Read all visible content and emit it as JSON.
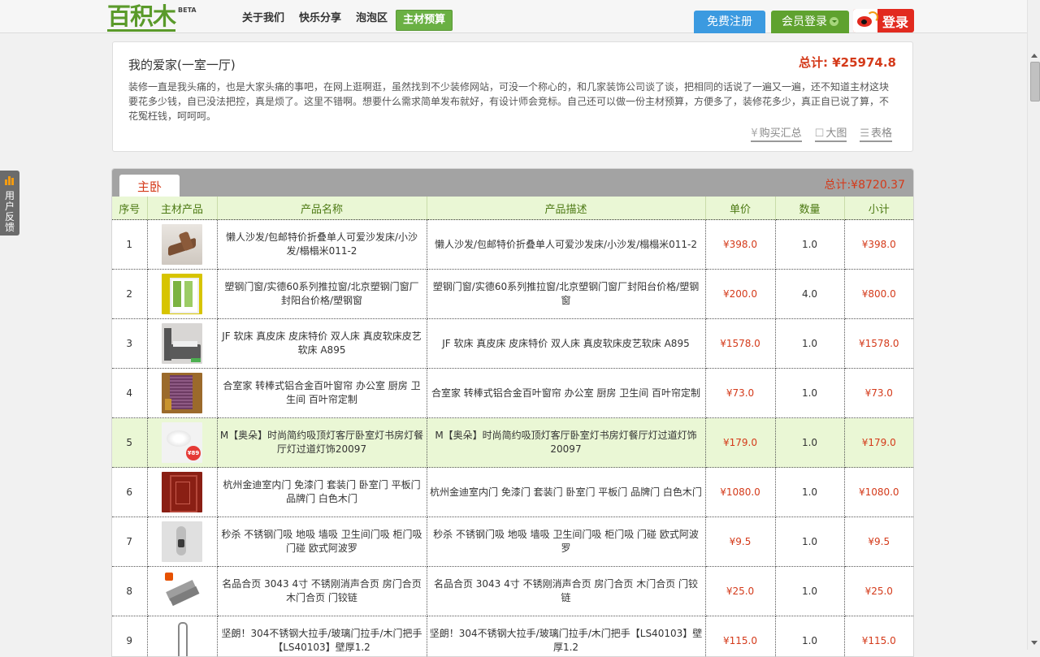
{
  "header": {
    "logo_text": "百积木",
    "logo_badge": "BETA",
    "nav": [
      "关于我们",
      "快乐分享",
      "泡泡区",
      "主材预算"
    ],
    "nav_active_index": 3,
    "register_label": "免费注册",
    "member_login_label": "会员登录",
    "weibo_login_label": "登录"
  },
  "feedback": {
    "label": "用户反馈"
  },
  "intro": {
    "title": "我的爱家(一室一厅)",
    "total": "总计: ¥25974.8",
    "description": "装修一直是我头痛的，也是大家头痛的事吧，在网上逛啊逛，虽然找到不少装修网站，可没一个称心的，和几家装饰公司谈了谈，把相同的话说了一遍又一遍，还不知道主材这块要花多少钱，自已没法把控，真是烦了。这里不错啊。想要什么需求简单发布就好，有设计师会竞标。自己还可以做一份主材预算，方便多了，装修花多少，真正自已说了算，不花冤枉钱，呵呵呵。",
    "views": [
      {
        "icon": "yen-icon",
        "glyph": "¥",
        "label": "购买汇总"
      },
      {
        "icon": "square-icon",
        "glyph": "☐",
        "label": "大图"
      },
      {
        "icon": "list-icon",
        "glyph": "☰",
        "label": "表格"
      }
    ]
  },
  "room": {
    "name": "主卧",
    "total": "总计:¥8720.37",
    "columns": [
      "序号",
      "主材产品",
      "产品名称",
      "产品描述",
      "单价",
      "数量",
      "小计"
    ],
    "rows": [
      {
        "no": "1",
        "name": "懒人沙发/包邮特价折叠单人可爱沙发床/小沙发/榻榻米011-2",
        "desc": "懒人沙发/包邮特价折叠单人可爱沙发床/小沙发/榻榻米011-2",
        "price": "¥398.0",
        "qty": "1.0",
        "subtotal": "¥398.0",
        "thumb": "sofa"
      },
      {
        "no": "2",
        "name": "塑钢门窗/实德60系列推拉窗/北京塑钢门窗厂封阳台价格/塑钢窗",
        "desc": "塑钢门窗/实德60系列推拉窗/北京塑钢门窗厂封阳台价格/塑钢窗",
        "price": "¥200.0",
        "qty": "4.0",
        "subtotal": "¥800.0",
        "thumb": "window"
      },
      {
        "no": "3",
        "name": "JF 软床 真皮床 皮床特价 双人床 真皮软床皮艺软床 A895",
        "desc": "JF 软床 真皮床 皮床特价 双人床 真皮软床皮艺软床 A895",
        "price": "¥1578.0",
        "qty": "1.0",
        "subtotal": "¥1578.0",
        "thumb": "bed"
      },
      {
        "no": "4",
        "name": "合室家 转棒式铝合金百叶窗帘 办公室 厨房 卫生间 百叶帘定制",
        "desc": "合室家 转棒式铝合金百叶窗帘 办公室 厨房 卫生间 百叶帘定制",
        "price": "¥73.0",
        "qty": "1.0",
        "subtotal": "¥73.0",
        "thumb": "blind"
      },
      {
        "no": "5",
        "name": "M【奥朵】时尚简约吸顶灯客厅卧室灯书房灯餐厅灯过道灯饰20097",
        "desc": "M【奥朵】时尚简约吸顶灯客厅卧室灯书房灯餐厅灯过道灯饰20097",
        "price": "¥179.0",
        "qty": "1.0",
        "subtotal": "¥179.0",
        "thumb": "lamp",
        "thumb_badge": "¥89"
      },
      {
        "no": "6",
        "name": "杭州金迪室内门 免漆门 套装门 卧室门 平板门 品牌门 白色木门",
        "desc": "杭州金迪室内门 免漆门 套装门 卧室门 平板门 品牌门 白色木门",
        "price": "¥1080.0",
        "qty": "1.0",
        "subtotal": "¥1080.0",
        "thumb": "door"
      },
      {
        "no": "7",
        "name": "秒杀 不锈钢门吸 地吸 墙吸 卫生间门吸 柜门吸 门碰 欧式阿波罗",
        "desc": "秒杀 不锈钢门吸 地吸 墙吸 卫生间门吸 柜门吸 门碰 欧式阿波罗",
        "price": "¥9.5",
        "qty": "1.0",
        "subtotal": "¥9.5",
        "thumb": "stopper"
      },
      {
        "no": "8",
        "name": "名品合页 3043 4寸 不锈刚消声合页 房门合页 木门合页 门铰链",
        "desc": "名品合页 3043 4寸 不锈刚消声合页 房门合页 木门合页 门铰链",
        "price": "¥25.0",
        "qty": "1.0",
        "subtotal": "¥25.0",
        "thumb": "hinge"
      },
      {
        "no": "9",
        "name": "坚朗！304不锈钢大拉手/玻璃门拉手/木门把手【LS40103】壁厚1.2",
        "desc": "坚朗！304不锈钢大拉手/玻璃门拉手/木门把手【LS40103】壁厚1.2",
        "price": "¥115.0",
        "qty": "1.0",
        "subtotal": "¥115.0",
        "thumb": "handle"
      }
    ],
    "highlight_row_index": 4
  }
}
